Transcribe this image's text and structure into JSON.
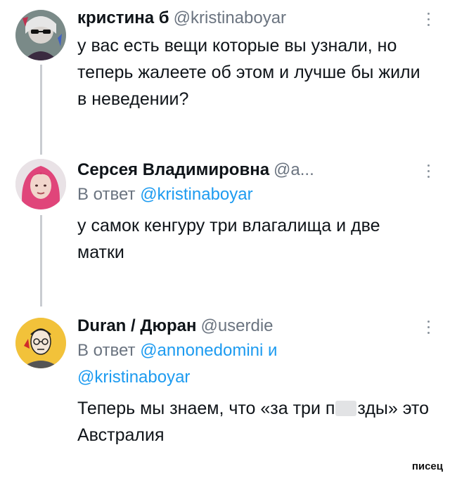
{
  "tweets": [
    {
      "name": "кристина б",
      "handle": "@kristinaboyar",
      "text": "у вас есть вещи которые вы узнали, но теперь жалеете об этом и лучше бы жили в неведении?",
      "avatar_icon": "avatar-sunglasses-woman"
    },
    {
      "name": "Серсея Владимировна",
      "handle": "@a...",
      "reply_prefix": "В ответ",
      "reply_mentions": [
        "@kristinaboyar"
      ],
      "text": "у самок кенгуру три влагалища и две матки",
      "avatar_icon": "avatar-pink-hair-woman"
    },
    {
      "name": "Duran / Дюран",
      "handle": "@userdie",
      "reply_prefix": "В ответ",
      "reply_mentions": [
        "@annonedomini",
        "@kristinaboyar"
      ],
      "reply_joiner": "и",
      "text_before": "Теперь мы знаем, что «за три п",
      "text_after": "зды» это Австралия",
      "avatar_icon": "avatar-drawn-man-glasses"
    }
  ],
  "watermark": "писец",
  "colors": {
    "link": "#1d9bf0",
    "muted": "#6b7480",
    "thread_line": "#c9ccd1"
  }
}
